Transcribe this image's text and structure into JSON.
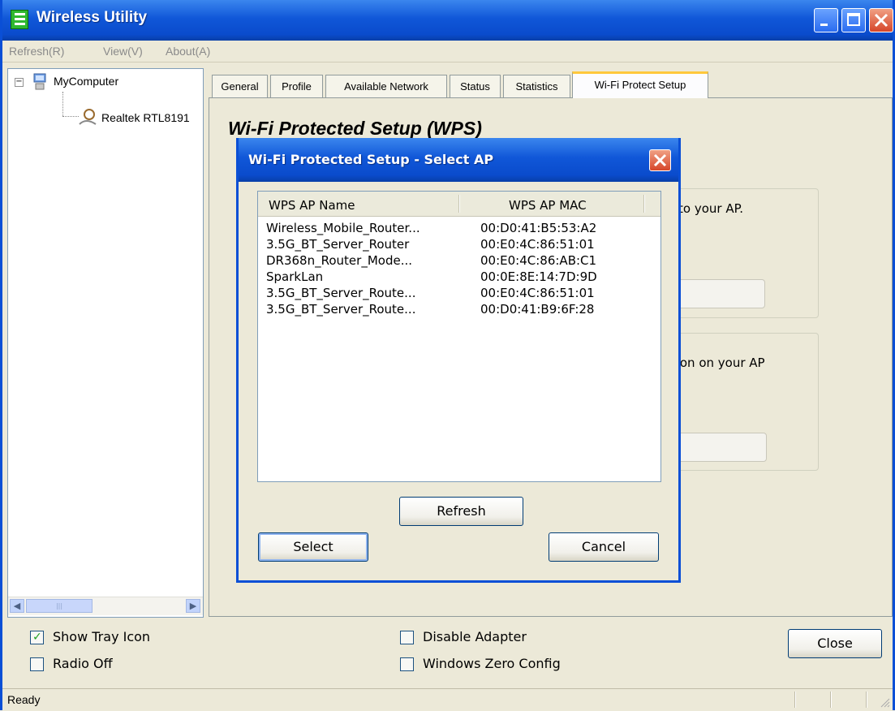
{
  "window": {
    "title": "Wireless Utility"
  },
  "menu": [
    "Refresh(R)",
    "View(V)",
    "About(A)"
  ],
  "tree": {
    "root": "MyComputer",
    "child": "Realtek RTL8191"
  },
  "tabs": [
    "General",
    "Profile",
    "Available Network",
    "Status",
    "Statistics",
    "Wi-Fi Protect Setup"
  ],
  "active_tab": "Wi-Fi Protect Setup",
  "wps": {
    "heading": "Wi-Fi Protected Setup (WPS)",
    "pin_text_fragment": "to your AP.",
    "pbc_text_fragment": "ton on your AP"
  },
  "dialog": {
    "title": "Wi-Fi Protected Setup - Select AP",
    "columns": [
      "WPS AP Name",
      "WPS AP MAC"
    ],
    "rows": [
      {
        "name": "Wireless_Mobile_Router...",
        "mac": "00:D0:41:B5:53:A2"
      },
      {
        "name": "3.5G_BT_Server_Router",
        "mac": "00:E0:4C:86:51:01"
      },
      {
        "name": "DR368n_Router_Mode...",
        "mac": "00:E0:4C:86:AB:C1"
      },
      {
        "name": "SparkLan",
        "mac": "00:0E:8E:14:7D:9D"
      },
      {
        "name": "3.5G_BT_Server_Route...",
        "mac": "00:E0:4C:86:51:01"
      },
      {
        "name": "3.5G_BT_Server_Route...",
        "mac": "00:D0:41:B9:6F:28"
      }
    ],
    "refresh_label": "Refresh",
    "select_label": "Select",
    "cancel_label": "Cancel"
  },
  "options": {
    "show_tray_icon": {
      "label": "Show Tray Icon",
      "checked": true
    },
    "radio_off": {
      "label": "Radio Off",
      "checked": false
    },
    "disable_adapter": {
      "label": "Disable Adapter",
      "checked": false
    },
    "windows_zero_config": {
      "label": "Windows Zero Config",
      "checked": false
    }
  },
  "close_label": "Close",
  "status": "Ready",
  "colors": {
    "title_blue": "#0a4fd6",
    "face": "#ece9d8",
    "tab_highlight": "#ffc83c",
    "check_green": "#21a121"
  }
}
